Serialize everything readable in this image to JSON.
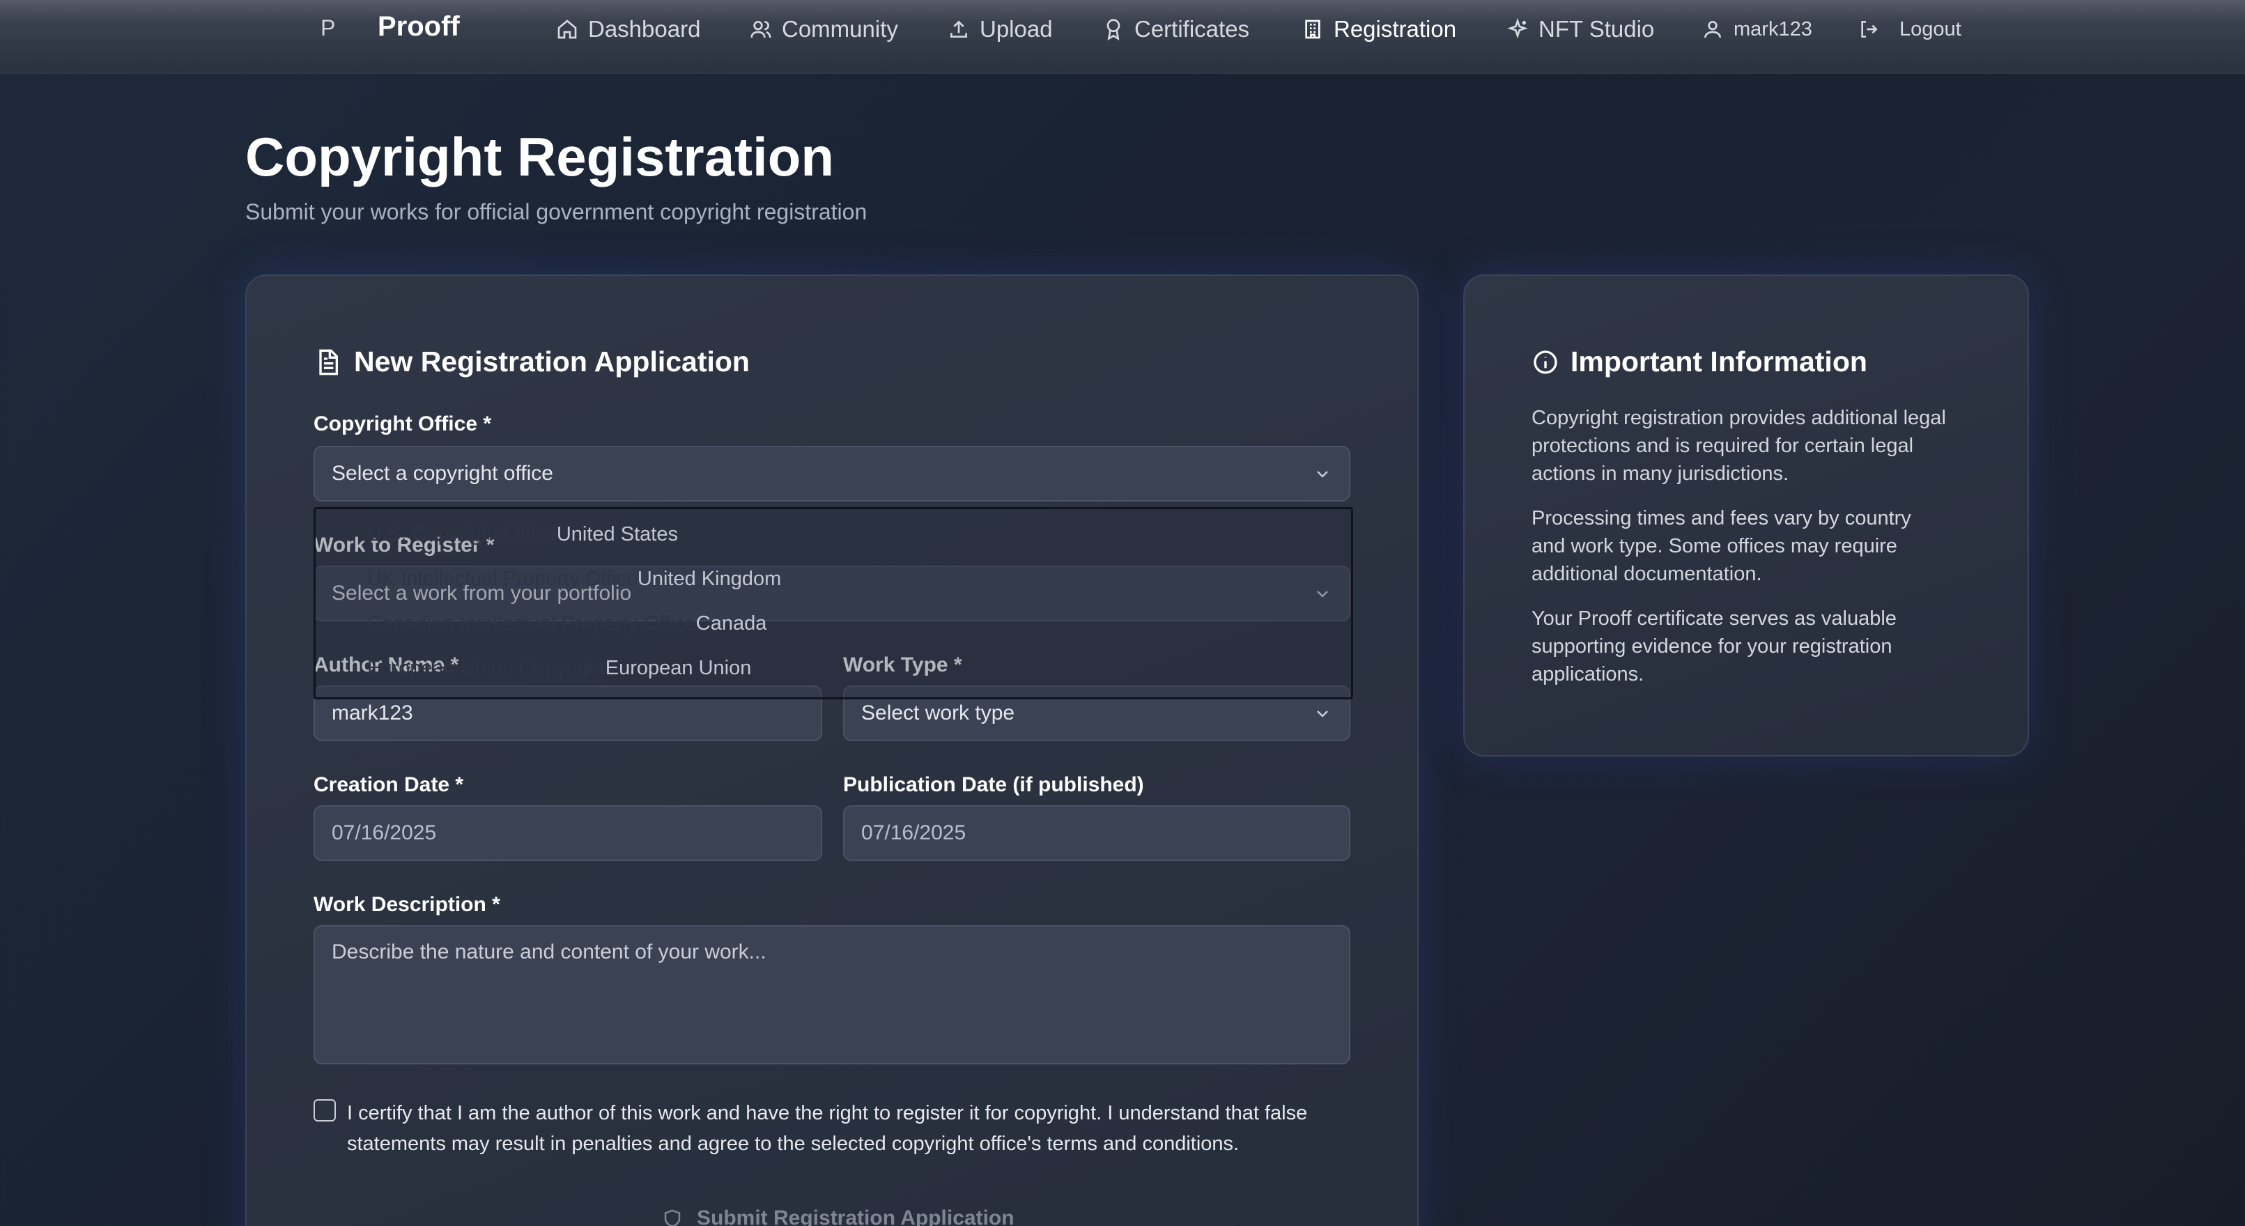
{
  "nav": {
    "logo_mark": "P",
    "brand": "Prooff",
    "items": [
      {
        "label": "Dashboard",
        "icon": "home-icon"
      },
      {
        "label": "Community",
        "icon": "users-icon"
      },
      {
        "label": "Upload",
        "icon": "upload-icon"
      },
      {
        "label": "Certificates",
        "icon": "award-icon"
      },
      {
        "label": "Registration",
        "icon": "building-icon",
        "active": true
      },
      {
        "label": "NFT Studio",
        "icon": "sparkles-icon"
      },
      {
        "label": "mark123",
        "icon": "user-icon"
      },
      {
        "label": "Logout",
        "icon": "logout-icon"
      }
    ]
  },
  "header": {
    "title": "Copyright Registration",
    "subtitle": "Submit your works for official government copyright registration"
  },
  "form": {
    "heading": "New Registration Application",
    "copyright_office": {
      "label": "Copyright Office *",
      "value": "Select a copyright office",
      "options": [
        {
          "name": "U.S. Copyright Office",
          "country": "United States"
        },
        {
          "name": "UK Intellectual Property Office",
          "country": "United Kingdom"
        },
        {
          "name": "Canadian Intellectual Property Office",
          "country": "Canada"
        },
        {
          "name": "European Union Copyright",
          "country": "European Union"
        }
      ]
    },
    "work": {
      "label": "Work to Register *",
      "value": "Select a work from your portfolio"
    },
    "author": {
      "label": "Author Name *",
      "value": "mark123"
    },
    "work_type": {
      "label": "Work Type *",
      "value": "Select work type"
    },
    "creation_date": {
      "label": "Creation Date *",
      "value": "07/16/2025"
    },
    "publication_date": {
      "label": "Publication Date (if published)",
      "value": "07/16/2025"
    },
    "description": {
      "label": "Work Description *",
      "placeholder": "Describe the nature and content of your work..."
    },
    "certify_text": "I certify that I am the author of this work and have the right to register it for copyright. I understand that false statements may result in penalties and agree to the selected copyright office's terms and conditions.",
    "submit_label": "Submit Registration Application"
  },
  "info": {
    "heading": "Important Information",
    "paragraphs": [
      "Copyright registration provides additional legal protections and is required for certain legal actions in many jurisdictions.",
      "Processing times and fees vary by country and work type. Some offices may require additional documentation.",
      "Your Prooff certificate serves as valuable supporting evidence for your registration applications."
    ]
  },
  "colors": {
    "background": "#1c2333",
    "card": "#2b3240",
    "field": "#3a4254",
    "border": "#4a5366",
    "muted_text": "#aab2c0"
  }
}
